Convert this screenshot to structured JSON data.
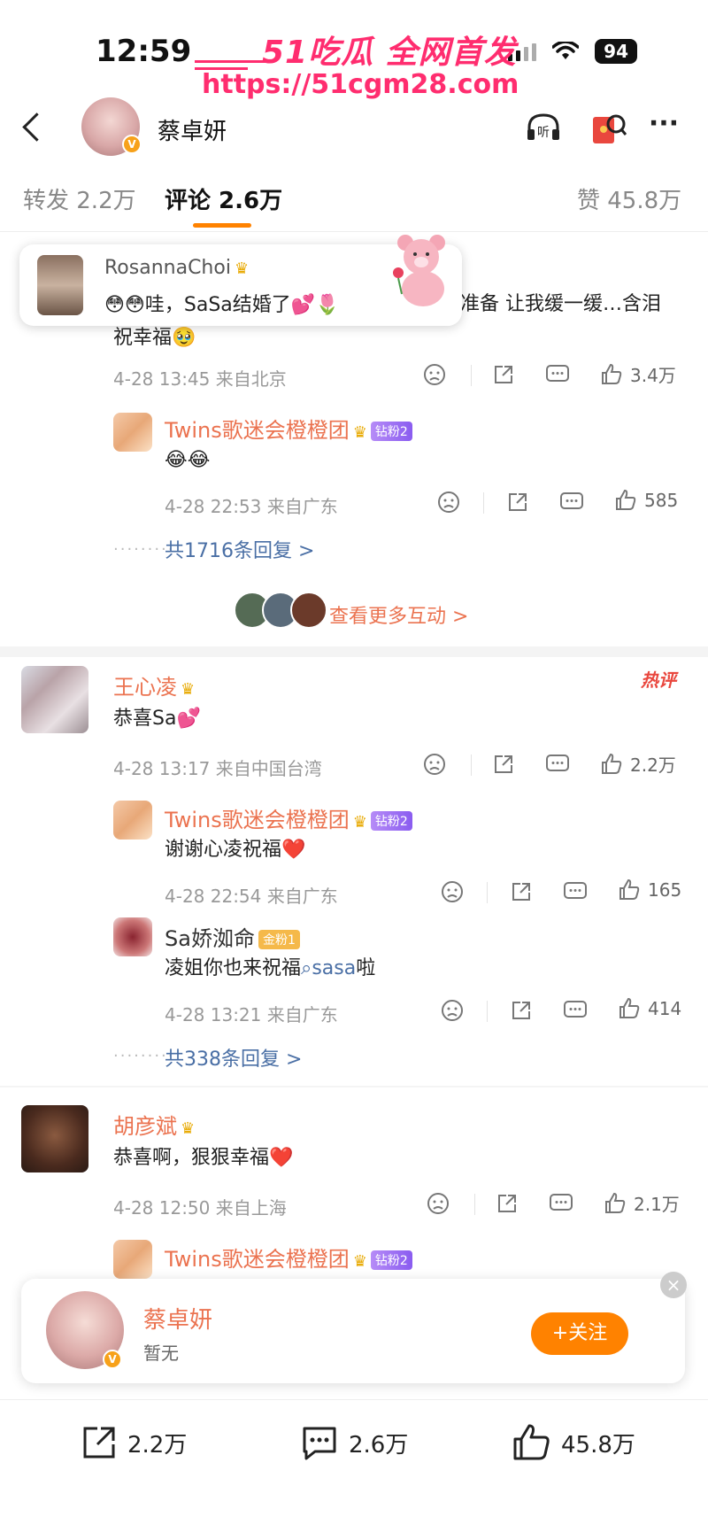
{
  "status_bar": {
    "time": "12:59",
    "battery": "94"
  },
  "watermark": {
    "title": "51吃瓜 全网首发",
    "url": "https://51cgm28.com"
  },
  "header": {
    "name": "蔡卓妍"
  },
  "tabs": [
    {
      "label": "转发 2.2万"
    },
    {
      "label": "评论 2.6万"
    },
    {
      "label": "赞 45.8万"
    }
  ],
  "popup": {
    "username": "RosannaChoi",
    "text": "😳😳哇，SaSa结婚了💕🌷"
  },
  "comments": [
    {
      "content_tail": "全准备 让我缓一缓…含泪",
      "content_line2": "祝幸福🥹",
      "meta": "4-28 13:45 来自北京",
      "likes": "3.4万",
      "replies": [
        {
          "username": "Twins歌迷会橙橙团",
          "badge": "钻粉2",
          "content": "😂😂",
          "meta": "4-28 22:53 来自广东",
          "likes": "585"
        }
      ],
      "reply_link": "共1716条回复 >"
    },
    {
      "username": "王心凌",
      "hot_tag": "热评",
      "content": "恭喜Sa💕",
      "meta": "4-28 13:17 来自中国台湾",
      "likes": "2.2万",
      "replies": [
        {
          "username": "Twins歌迷会橙橙团",
          "badge": "钻粉2",
          "content": "谢谢心凌祝福❤️",
          "meta": "4-28 22:54 来自广东",
          "likes": "165"
        },
        {
          "username": "Sa娇洳命",
          "badge": "金粉1",
          "content_prefix": "凌姐你也来祝福",
          "content_link": "sasa",
          "content_suffix": "啦",
          "meta": "4-28 13:21 来自广东",
          "likes": "414"
        }
      ],
      "reply_link": "共338条回复 >"
    },
    {
      "username": "胡彦斌",
      "content": "恭喜啊，狠狠幸福❤️",
      "meta": "4-28 12:50 来自上海",
      "likes": "2.1万",
      "replies": [
        {
          "username": "Twins歌迷会橙橙团",
          "badge": "钻粉2"
        }
      ]
    }
  ],
  "more_interactions": "查看更多互动 >",
  "follow_card": {
    "name": "蔡卓妍",
    "subtitle": "暂无",
    "button": "+关注"
  },
  "bottom_bar": {
    "reposts": "2.2万",
    "comments": "2.6万",
    "likes": "45.8万"
  },
  "colors": {
    "accent": "#ff8200",
    "username": "#eb7350",
    "link": "#4a6fa5",
    "watermark": "#ff2d6f"
  },
  "icons": [
    "back-icon",
    "listen-icon",
    "red-packet-icon",
    "more-icon",
    "dislike-icon",
    "share-icon",
    "comment-icon",
    "like-icon"
  ]
}
